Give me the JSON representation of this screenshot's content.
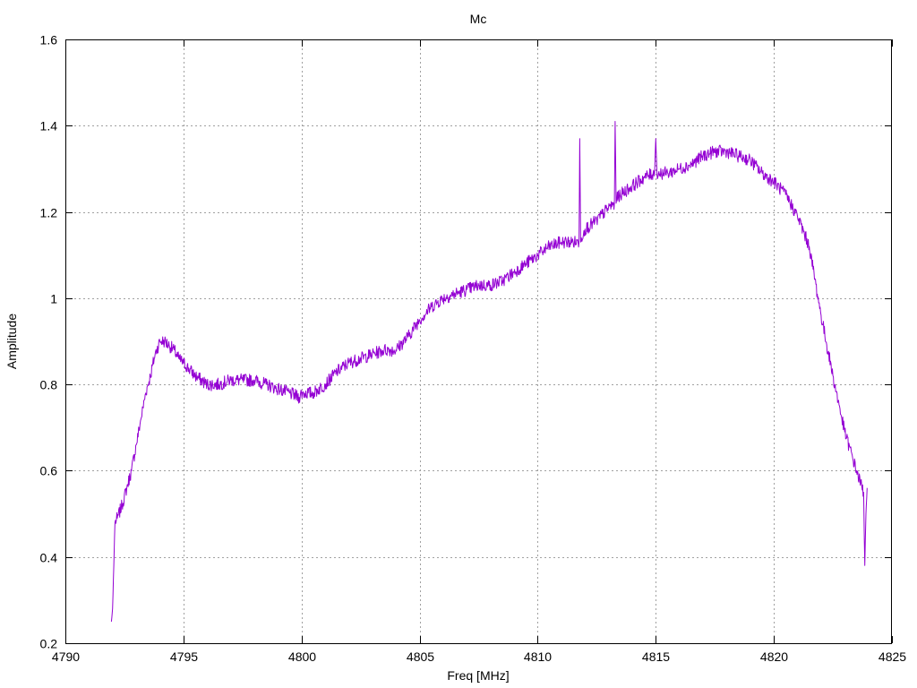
{
  "chart_data": {
    "type": "line",
    "title": "Mc",
    "xlabel": "Freq [MHz]",
    "ylabel": "Amplitude",
    "xlim": [
      4790,
      4825
    ],
    "ylim": [
      0.2,
      1.6
    ],
    "xticks": [
      4790,
      4795,
      4800,
      4805,
      4810,
      4815,
      4820,
      4825
    ],
    "yticks": [
      0.2,
      0.4,
      0.6,
      0.8,
      1.0,
      1.2,
      1.4,
      1.6
    ],
    "ytick_labels": [
      "0.2",
      "0.4",
      "0.6",
      "0.8",
      "1",
      "1.2",
      "1.4",
      "1.6"
    ],
    "grid": true,
    "legend": "none",
    "series": [
      {
        "color": "#9400d3",
        "x": [
          4791.95,
          4792.0,
          4792.05,
          4792.1,
          4792.2,
          4792.4,
          4792.6,
          4792.8,
          4793.0,
          4793.2,
          4793.4,
          4793.6,
          4793.8,
          4794.0,
          4794.2,
          4794.4,
          4794.6,
          4794.8,
          4795.0,
          4795.5,
          4796.0,
          4796.5,
          4797.0,
          4797.5,
          4798.0,
          4798.5,
          4799.0,
          4799.5,
          4799.9,
          4800.0,
          4800.5,
          4801.0,
          4801.5,
          4802.0,
          4802.5,
          4803.0,
          4803.5,
          4804.0,
          4804.5,
          4805.0,
          4805.5,
          4806.0,
          4806.5,
          4807.0,
          4807.5,
          4808.0,
          4808.5,
          4809.0,
          4809.5,
          4810.0,
          4810.5,
          4811.0,
          4811.5,
          4811.75,
          4811.78,
          4811.82,
          4811.85,
          4812.0,
          4812.5,
          4813.0,
          4813.25,
          4813.28,
          4813.32,
          4813.35,
          4813.5,
          4814.0,
          4814.5,
          4814.95,
          4815.0,
          4815.05,
          4815.5,
          4816.0,
          4816.5,
          4817.0,
          4817.5,
          4818.0,
          4818.5,
          4819.0,
          4819.5,
          4820.0,
          4820.5,
          4821.0,
          4821.5,
          4822.0,
          4822.5,
          4823.0,
          4823.5,
          4823.8,
          4823.85,
          4823.9,
          4823.95
        ],
        "y": [
          0.25,
          0.28,
          0.38,
          0.48,
          0.49,
          0.52,
          0.56,
          0.6,
          0.66,
          0.72,
          0.78,
          0.82,
          0.87,
          0.9,
          0.9,
          0.89,
          0.88,
          0.86,
          0.85,
          0.82,
          0.8,
          0.8,
          0.81,
          0.81,
          0.81,
          0.8,
          0.79,
          0.78,
          0.77,
          0.78,
          0.78,
          0.8,
          0.83,
          0.85,
          0.86,
          0.87,
          0.88,
          0.88,
          0.91,
          0.95,
          0.98,
          1.0,
          1.01,
          1.02,
          1.03,
          1.03,
          1.04,
          1.06,
          1.08,
          1.1,
          1.12,
          1.13,
          1.13,
          1.13,
          1.37,
          1.13,
          1.14,
          1.16,
          1.18,
          1.21,
          1.22,
          1.41,
          1.22,
          1.23,
          1.24,
          1.26,
          1.28,
          1.29,
          1.37,
          1.29,
          1.29,
          1.3,
          1.31,
          1.33,
          1.34,
          1.34,
          1.33,
          1.32,
          1.29,
          1.27,
          1.24,
          1.19,
          1.12,
          0.96,
          0.82,
          0.69,
          0.6,
          0.55,
          0.38,
          0.5,
          0.56
        ]
      }
    ]
  }
}
